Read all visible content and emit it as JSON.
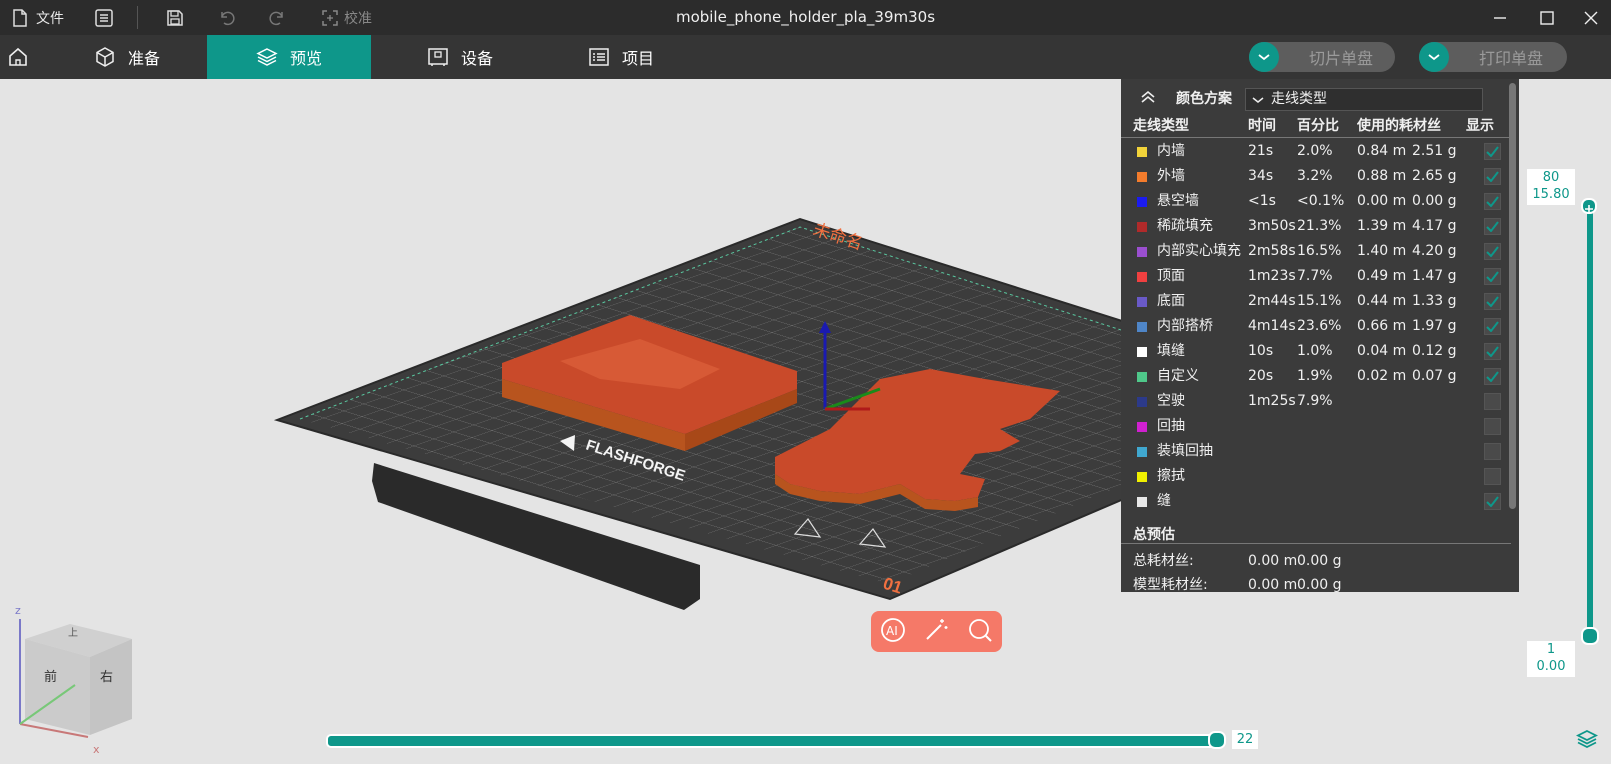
{
  "titlebar": {
    "file_label": "文件",
    "calibrate_label": "校准",
    "title": "mobile_phone_holder_pla_39m30s"
  },
  "nav": {
    "tabs": [
      {
        "label": "准备",
        "icon": "cube-icon",
        "active": false
      },
      {
        "label": "预览",
        "icon": "layers-icon",
        "active": true
      },
      {
        "label": "设备",
        "icon": "device-icon",
        "active": false
      },
      {
        "label": "项目",
        "icon": "list-icon",
        "active": false
      }
    ],
    "slice_button": "切片单盘",
    "print_button": "打印单盘"
  },
  "viewport": {
    "plate_name": "未命名",
    "plate_number": "01",
    "brand": "FLASHFORGE",
    "view_cube": {
      "front": "前",
      "right": "右",
      "top": "上"
    },
    "axes": {
      "x": "x",
      "z": "z"
    }
  },
  "panel": {
    "color_scheme_label": "颜色方案",
    "color_scheme_value": "走线类型",
    "columns": [
      "走线类型",
      "时间",
      "百分比",
      "使用的耗材丝",
      "显示"
    ],
    "rows": [
      {
        "type": "内墙",
        "color": "#f2d33a",
        "time": "21s",
        "percent": "2.0%",
        "length": "0.84 m",
        "weight": "2.51 g",
        "shown": true
      },
      {
        "type": "外墙",
        "color": "#f47c2c",
        "time": "34s",
        "percent": "3.2%",
        "length": "0.88 m",
        "weight": "2.65 g",
        "shown": true
      },
      {
        "type": "悬空墙",
        "color": "#1b1bf0",
        "time": "<1s",
        "percent": "<0.1%",
        "length": "0.00 m",
        "weight": "0.00 g",
        "shown": true
      },
      {
        "type": "稀疏填充",
        "color": "#b02a2a",
        "time": "3m50s",
        "percent": "21.3%",
        "length": "1.39 m",
        "weight": "4.17 g",
        "shown": true
      },
      {
        "type": "内部实心填充",
        "color": "#9b4fd0",
        "time": "2m58s",
        "percent": "16.5%",
        "length": "1.40 m",
        "weight": "4.20 g",
        "shown": true
      },
      {
        "type": "顶面",
        "color": "#f04040",
        "time": "1m23s",
        "percent": "7.7%",
        "length": "0.49 m",
        "weight": "1.47 g",
        "shown": true
      },
      {
        "type": "底面",
        "color": "#6a5ac8",
        "time": "2m44s",
        "percent": "15.1%",
        "length": "0.44 m",
        "weight": "1.33 g",
        "shown": true
      },
      {
        "type": "内部搭桥",
        "color": "#4f86c8",
        "time": "4m14s",
        "percent": "23.6%",
        "length": "0.66 m",
        "weight": "1.97 g",
        "shown": true
      },
      {
        "type": "填缝",
        "color": "#ffffff",
        "time": "10s",
        "percent": "1.0%",
        "length": "0.04 m",
        "weight": "0.12 g",
        "shown": true
      },
      {
        "type": "自定义",
        "color": "#4fc88a",
        "time": "20s",
        "percent": "1.9%",
        "length": "0.02 m",
        "weight": "0.07 g",
        "shown": true
      },
      {
        "type": "空驶",
        "color": "#2c3a8a",
        "time": "1m25s",
        "percent": "7.9%",
        "length": "",
        "weight": "",
        "shown": false
      },
      {
        "type": "回抽",
        "color": "#d020d0",
        "time": "",
        "percent": "",
        "length": "",
        "weight": "",
        "shown": false
      },
      {
        "type": "装填回抽",
        "color": "#40a8d0",
        "time": "",
        "percent": "",
        "length": "",
        "weight": "",
        "shown": false
      },
      {
        "type": "擦拭",
        "color": "#f0f000",
        "time": "",
        "percent": "",
        "length": "",
        "weight": "",
        "shown": false
      },
      {
        "type": "缝",
        "color": "#e8e8e8",
        "time": "",
        "percent": "",
        "length": "",
        "weight": "",
        "shown": true
      }
    ],
    "estimate_title": "总预估",
    "total_filament_label": "总耗材丝:",
    "total_filament_length": "0.00 m",
    "total_filament_weight": "0.00 g",
    "model_filament_label": "模型耗材丝:",
    "model_filament_length": "0.00 m",
    "model_filament_weight": "0.00 g"
  },
  "layer_slider": {
    "top_layer": "80",
    "top_height": "15.80",
    "bottom_layer": "1",
    "bottom_height": "0.00"
  },
  "move_slider": {
    "value": "22"
  },
  "colors": {
    "accent": "#0e978a",
    "ai_bar": "#f57968"
  }
}
